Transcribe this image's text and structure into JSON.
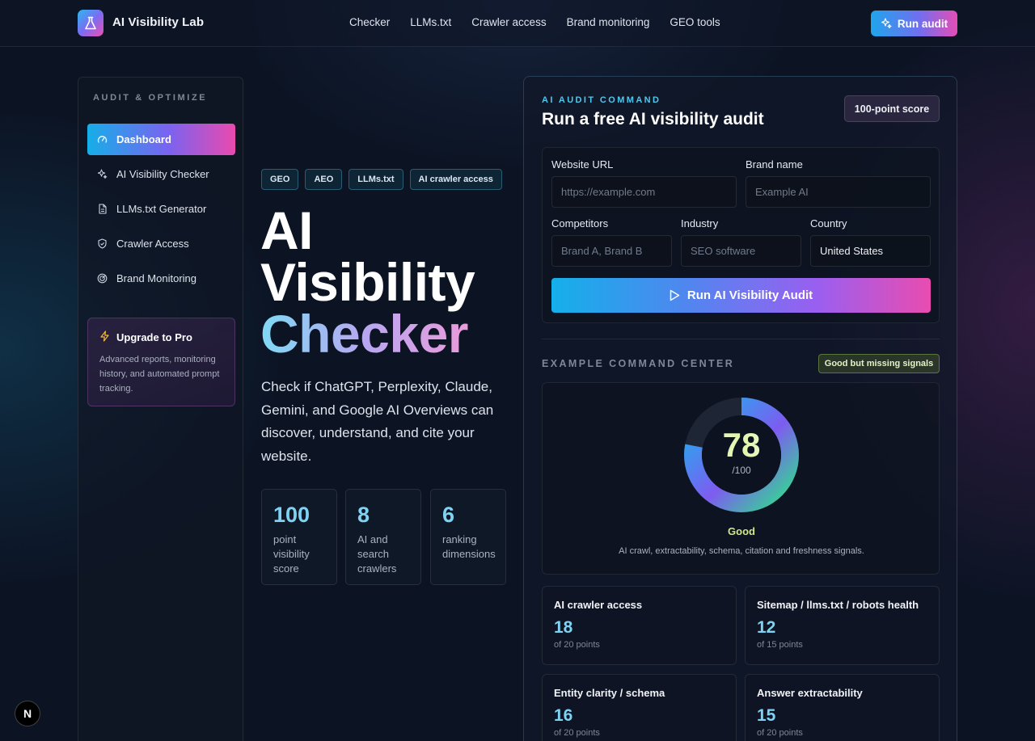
{
  "brand": {
    "name": "AI Visibility Lab",
    "logo_icon": "flask-icon"
  },
  "nav": {
    "links": [
      "Checker",
      "LLMs.txt",
      "Crawler access",
      "Brand monitoring",
      "GEO tools"
    ],
    "cta": "Run audit"
  },
  "sidebar": {
    "heading": "AUDIT & OPTIMIZE",
    "items": [
      {
        "label": "Dashboard",
        "icon": "gauge-icon",
        "active": true
      },
      {
        "label": "AI Visibility Checker",
        "icon": "sparkle-icon",
        "active": false
      },
      {
        "label": "LLMs.txt Generator",
        "icon": "document-icon",
        "active": false
      },
      {
        "label": "Crawler Access",
        "icon": "shield-icon",
        "active": false
      },
      {
        "label": "Brand Monitoring",
        "icon": "radar-icon",
        "active": false
      }
    ],
    "pro": {
      "title": "Upgrade to Pro",
      "icon": "lightning-icon",
      "text": "Advanced reports, monitoring history, and automated prompt tracking."
    }
  },
  "hero": {
    "tags": [
      "GEO",
      "AEO",
      "LLMs.txt",
      "AI crawler access"
    ],
    "title_line1": "AI",
    "title_line2": "Visibility",
    "title_line3": "Checker",
    "description": "Check if ChatGPT, Perplexity, Claude, Gemini, and Google AI Overviews can discover, understand, and cite your website.",
    "stats": [
      {
        "value": "100",
        "label": "point visibility score"
      },
      {
        "value": "8",
        "label": "AI and search crawlers"
      },
      {
        "value": "6",
        "label": "ranking dimensions"
      }
    ]
  },
  "audit": {
    "kicker": "AI AUDIT COMMAND",
    "title": "Run a free AI visibility audit",
    "score_pill": "100-point score",
    "fields": {
      "website_label": "Website URL",
      "website_placeholder": "https://example.com",
      "brand_label": "Brand name",
      "brand_placeholder": "Example AI",
      "competitors_label": "Competitors",
      "competitors_placeholder": "Brand A, Brand B",
      "industry_label": "Industry",
      "industry_placeholder": "SEO software",
      "country_label": "Country",
      "country_value": "United States"
    },
    "run_button": "Run AI Visibility Audit"
  },
  "command_center": {
    "heading": "EXAMPLE COMMAND CENTER",
    "status_badge": "Good but missing signals",
    "score": 78,
    "score_max": "/100",
    "rating": "Good",
    "description": "AI crawl, extractability, schema, citation and freshness signals.",
    "metrics": [
      {
        "title": "AI crawler access",
        "value": "18",
        "sub": "of 20 points"
      },
      {
        "title": "Sitemap / llms.txt / robots health",
        "value": "12",
        "sub": "of 15 points"
      },
      {
        "title": "Entity clarity / schema",
        "value": "16",
        "sub": "of 20 points"
      },
      {
        "title": "Answer extractability",
        "value": "15",
        "sub": "of 20 points"
      }
    ]
  },
  "colors": {
    "accent_cyan": "#1fa6ec",
    "accent_violet": "#7a63f0",
    "accent_pink": "#ea4aae",
    "good": "#cfe88a"
  },
  "corner_badge": "N"
}
